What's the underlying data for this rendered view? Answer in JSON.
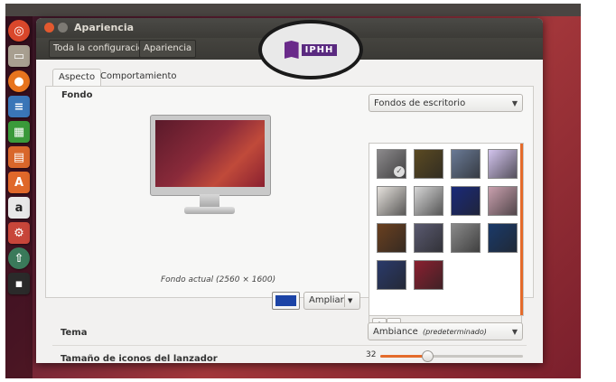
{
  "window": {
    "title": "Apariencia",
    "toolbar": {
      "all_settings_label": "Toda la configuración",
      "current_label": "Apariencia"
    },
    "close_color": "#e2592f",
    "minimize_color": "#7d7a74"
  },
  "logo": {
    "text": "IPHH"
  },
  "tabs": [
    {
      "label": "Aspecto",
      "active": true
    },
    {
      "label": "Comportamiento",
      "active": false
    }
  ],
  "fondo": {
    "section_label": "Fondo",
    "current_background_caption": "Fondo actual (2560 × 1600)",
    "color_swatch": "#1c44a6",
    "zoom_button_label": "Ampliar",
    "source_dropdown": "Fondos de escritorio",
    "add_button": "+",
    "remove_button": "−",
    "thumbnails": [
      {
        "name": "wallpaper-1",
        "color": "#8c8a8c",
        "selected": true
      },
      {
        "name": "wallpaper-2",
        "color": "#5b4a22"
      },
      {
        "name": "wallpaper-3",
        "color": "#6a7a96"
      },
      {
        "name": "wallpaper-4",
        "color": "#d3c4ee"
      },
      {
        "name": "wallpaper-5",
        "color": "#e6e2dd"
      },
      {
        "name": "wallpaper-6",
        "color": "#d6d6d6"
      },
      {
        "name": "wallpaper-7",
        "color": "#1a2a7a"
      },
      {
        "name": "wallpaper-8",
        "color": "#c9a0ae"
      },
      {
        "name": "wallpaper-9",
        "color": "#6a4020"
      },
      {
        "name": "wallpaper-10",
        "color": "#5a5a70"
      },
      {
        "name": "wallpaper-11",
        "color": "#8a8a8a"
      },
      {
        "name": "wallpaper-12",
        "color": "#1a3a6a"
      },
      {
        "name": "wallpaper-13",
        "color": "#2a3a6a"
      },
      {
        "name": "wallpaper-14",
        "color": "#8a2030"
      }
    ]
  },
  "tema": {
    "label": "Tema",
    "value": "Ambiance",
    "value_note": "(predeterminado)"
  },
  "launcher_icons": {
    "label": "Tamaño de iconos del lanzador",
    "value": "32",
    "slider_fraction": 0.33
  },
  "accent_color": "#e46b2b"
}
